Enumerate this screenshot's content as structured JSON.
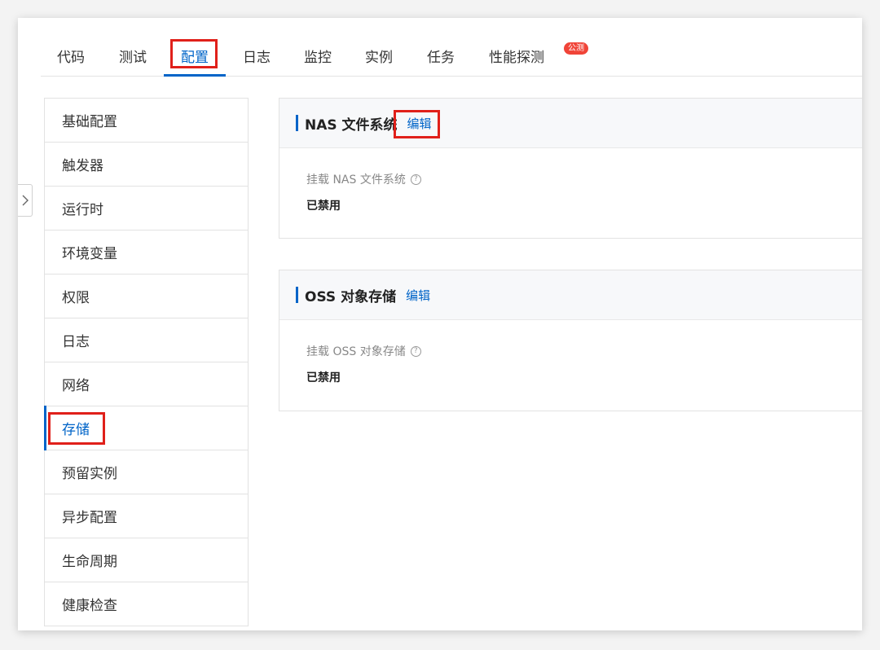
{
  "tabs": [
    {
      "label": "代码",
      "active": false
    },
    {
      "label": "测试",
      "active": false
    },
    {
      "label": "配置",
      "active": true
    },
    {
      "label": "日志",
      "active": false
    },
    {
      "label": "监控",
      "active": false
    },
    {
      "label": "实例",
      "active": false
    },
    {
      "label": "任务",
      "active": false
    },
    {
      "label": "性能探测",
      "active": false,
      "badge": "公测"
    }
  ],
  "sidebar": {
    "items": [
      {
        "label": "基础配置",
        "active": false
      },
      {
        "label": "触发器",
        "active": false
      },
      {
        "label": "运行时",
        "active": false
      },
      {
        "label": "环境变量",
        "active": false
      },
      {
        "label": "权限",
        "active": false
      },
      {
        "label": "日志",
        "active": false
      },
      {
        "label": "网络",
        "active": false
      },
      {
        "label": "存储",
        "active": true
      },
      {
        "label": "预留实例",
        "active": false
      },
      {
        "label": "异步配置",
        "active": false
      },
      {
        "label": "生命周期",
        "active": false
      },
      {
        "label": "健康检查",
        "active": false
      }
    ]
  },
  "cards": [
    {
      "title": "NAS 文件系统",
      "edit_label": "编辑",
      "field_label": "挂载 NAS 文件系统",
      "field_value": "已禁用"
    },
    {
      "title": "OSS 对象存储",
      "edit_label": "编辑",
      "field_label": "挂载 OSS 对象存储",
      "field_value": "已禁用"
    }
  ],
  "icons": {
    "help": "question-circle-icon",
    "collapse": "chevron-right-icon"
  },
  "colors": {
    "accent": "#0064c8",
    "highlight": "#e0201a",
    "badge": "#f04438"
  }
}
